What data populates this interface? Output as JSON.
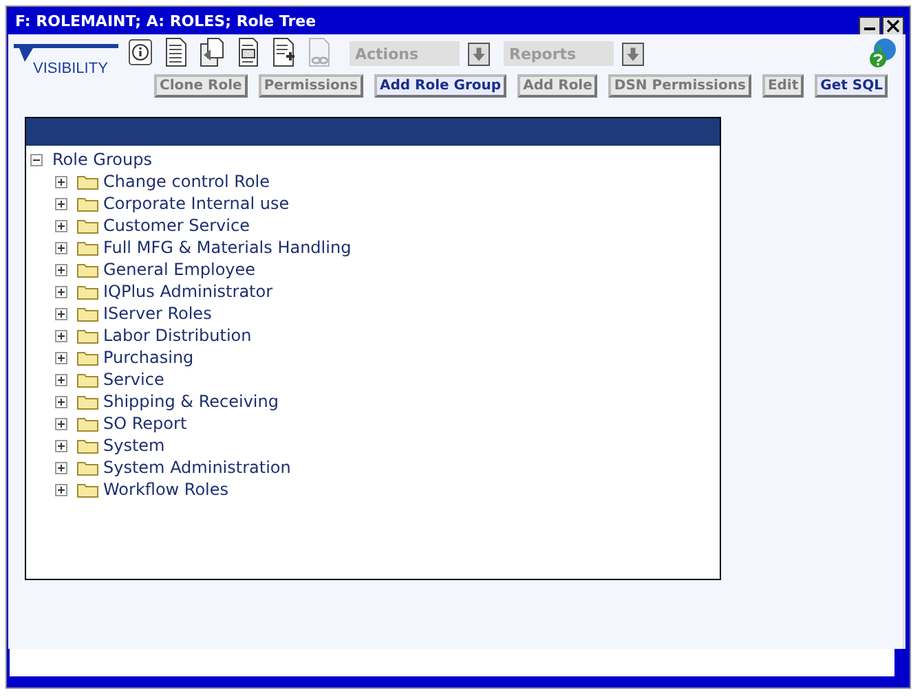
{
  "window": {
    "title": "F: ROLEMAINT; A: ROLES; Role Tree"
  },
  "logo": {
    "text": "VISIBILITY"
  },
  "toolbar_icons": [
    {
      "kind": "info",
      "disabled": false
    },
    {
      "kind": "document",
      "disabled": false
    },
    {
      "kind": "copy",
      "disabled": false
    },
    {
      "kind": "print",
      "disabled": false
    },
    {
      "kind": "new",
      "disabled": false
    },
    {
      "kind": "link",
      "disabled": true
    }
  ],
  "dropdowns": [
    {
      "label": "Actions",
      "disabled": true
    },
    {
      "label": "Reports",
      "disabled": true
    }
  ],
  "buttons": [
    {
      "label": "Clone Role",
      "disabled": true
    },
    {
      "label": "Permissions",
      "disabled": true
    },
    {
      "label": "Add Role Group",
      "disabled": false
    },
    {
      "label": "Add Role",
      "disabled": true
    },
    {
      "label": "DSN Permissions",
      "disabled": true
    },
    {
      "label": "Edit",
      "disabled": true
    },
    {
      "label": "Get SQL",
      "disabled": false
    }
  ],
  "tree": {
    "label": "Role Groups",
    "expanded": true,
    "children": [
      {
        "label": "Change control Role",
        "expanded": false
      },
      {
        "label": "Corporate Internal use",
        "expanded": false
      },
      {
        "label": "Customer Service",
        "expanded": false
      },
      {
        "label": "Full MFG & Materials Handling",
        "expanded": false
      },
      {
        "label": "General Employee",
        "expanded": false
      },
      {
        "label": "IQPlus Administrator",
        "expanded": false
      },
      {
        "label": "IServer Roles",
        "expanded": false
      },
      {
        "label": "Labor Distribution",
        "expanded": false
      },
      {
        "label": "Purchasing",
        "expanded": false
      },
      {
        "label": "Service",
        "expanded": false
      },
      {
        "label": "Shipping & Receiving",
        "expanded": false
      },
      {
        "label": "SO Report",
        "expanded": false
      },
      {
        "label": "System",
        "expanded": false
      },
      {
        "label": "System Administration",
        "expanded": false
      },
      {
        "label": "Workflow Roles",
        "expanded": false
      }
    ]
  }
}
